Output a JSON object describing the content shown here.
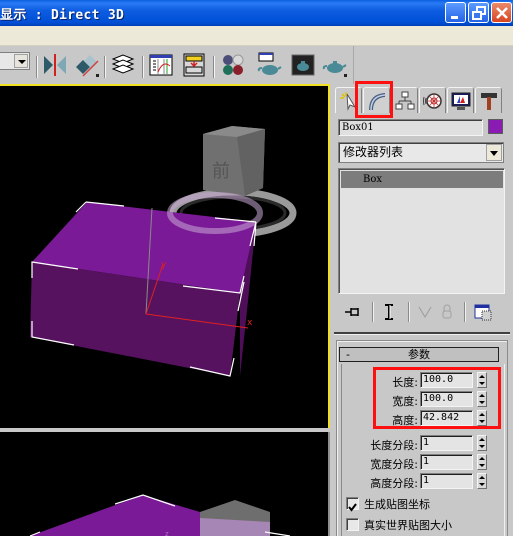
{
  "window": {
    "title": "显示 : Direct 3D",
    "controls": {
      "minimize": "minimize",
      "restore": "restore",
      "close": "close"
    }
  },
  "toolbar": {
    "icons": [
      "mirror-icon",
      "align-icon",
      "layer-manager-icon",
      "curve-editor-icon",
      "schematic-view-icon",
      "material-editor-icon",
      "render-setup-icon",
      "rendered-frame-icon",
      "quick-render-icon"
    ]
  },
  "viewport": {
    "viewcube_label": "前",
    "axis_labels": {
      "x": "x",
      "y": "y",
      "z": "z"
    },
    "object_color": "#7a1a96",
    "active_border_color": "#f0e020"
  },
  "command_panel": {
    "tabs": [
      {
        "name": "create",
        "icon": "create-icon"
      },
      {
        "name": "modify",
        "icon": "modify-icon",
        "active": true
      },
      {
        "name": "hierarchy",
        "icon": "hierarchy-icon"
      },
      {
        "name": "motion",
        "icon": "motion-icon"
      },
      {
        "name": "display",
        "icon": "display-icon"
      },
      {
        "name": "utilities",
        "icon": "utilities-icon"
      }
    ],
    "object_name": "Box01",
    "object_color": "#8a1cb4",
    "modifier_list": "修改器列表",
    "stack_items": [
      "Box"
    ],
    "stack_tools": [
      "pin-stack-icon",
      "show-end-result-icon",
      "make-unique-icon",
      "remove-modifier-icon",
      "configure-modifier-sets-icon"
    ],
    "rollout": {
      "title": "参数",
      "collapse": "-",
      "params": [
        {
          "label": "长度:",
          "value": "100.0"
        },
        {
          "label": "宽度:",
          "value": "100.0"
        },
        {
          "label": "高度:",
          "value": "42.842"
        }
      ],
      "segments": [
        {
          "label": "长度分段:",
          "value": "1"
        },
        {
          "label": "宽度分段:",
          "value": "1"
        },
        {
          "label": "高度分段:",
          "value": "1"
        }
      ],
      "checkboxes": [
        {
          "label": "生成贴图坐标",
          "checked": true
        },
        {
          "label": "真实世界贴图大小",
          "checked": false
        }
      ]
    }
  },
  "highlight_color": "#ff1010"
}
